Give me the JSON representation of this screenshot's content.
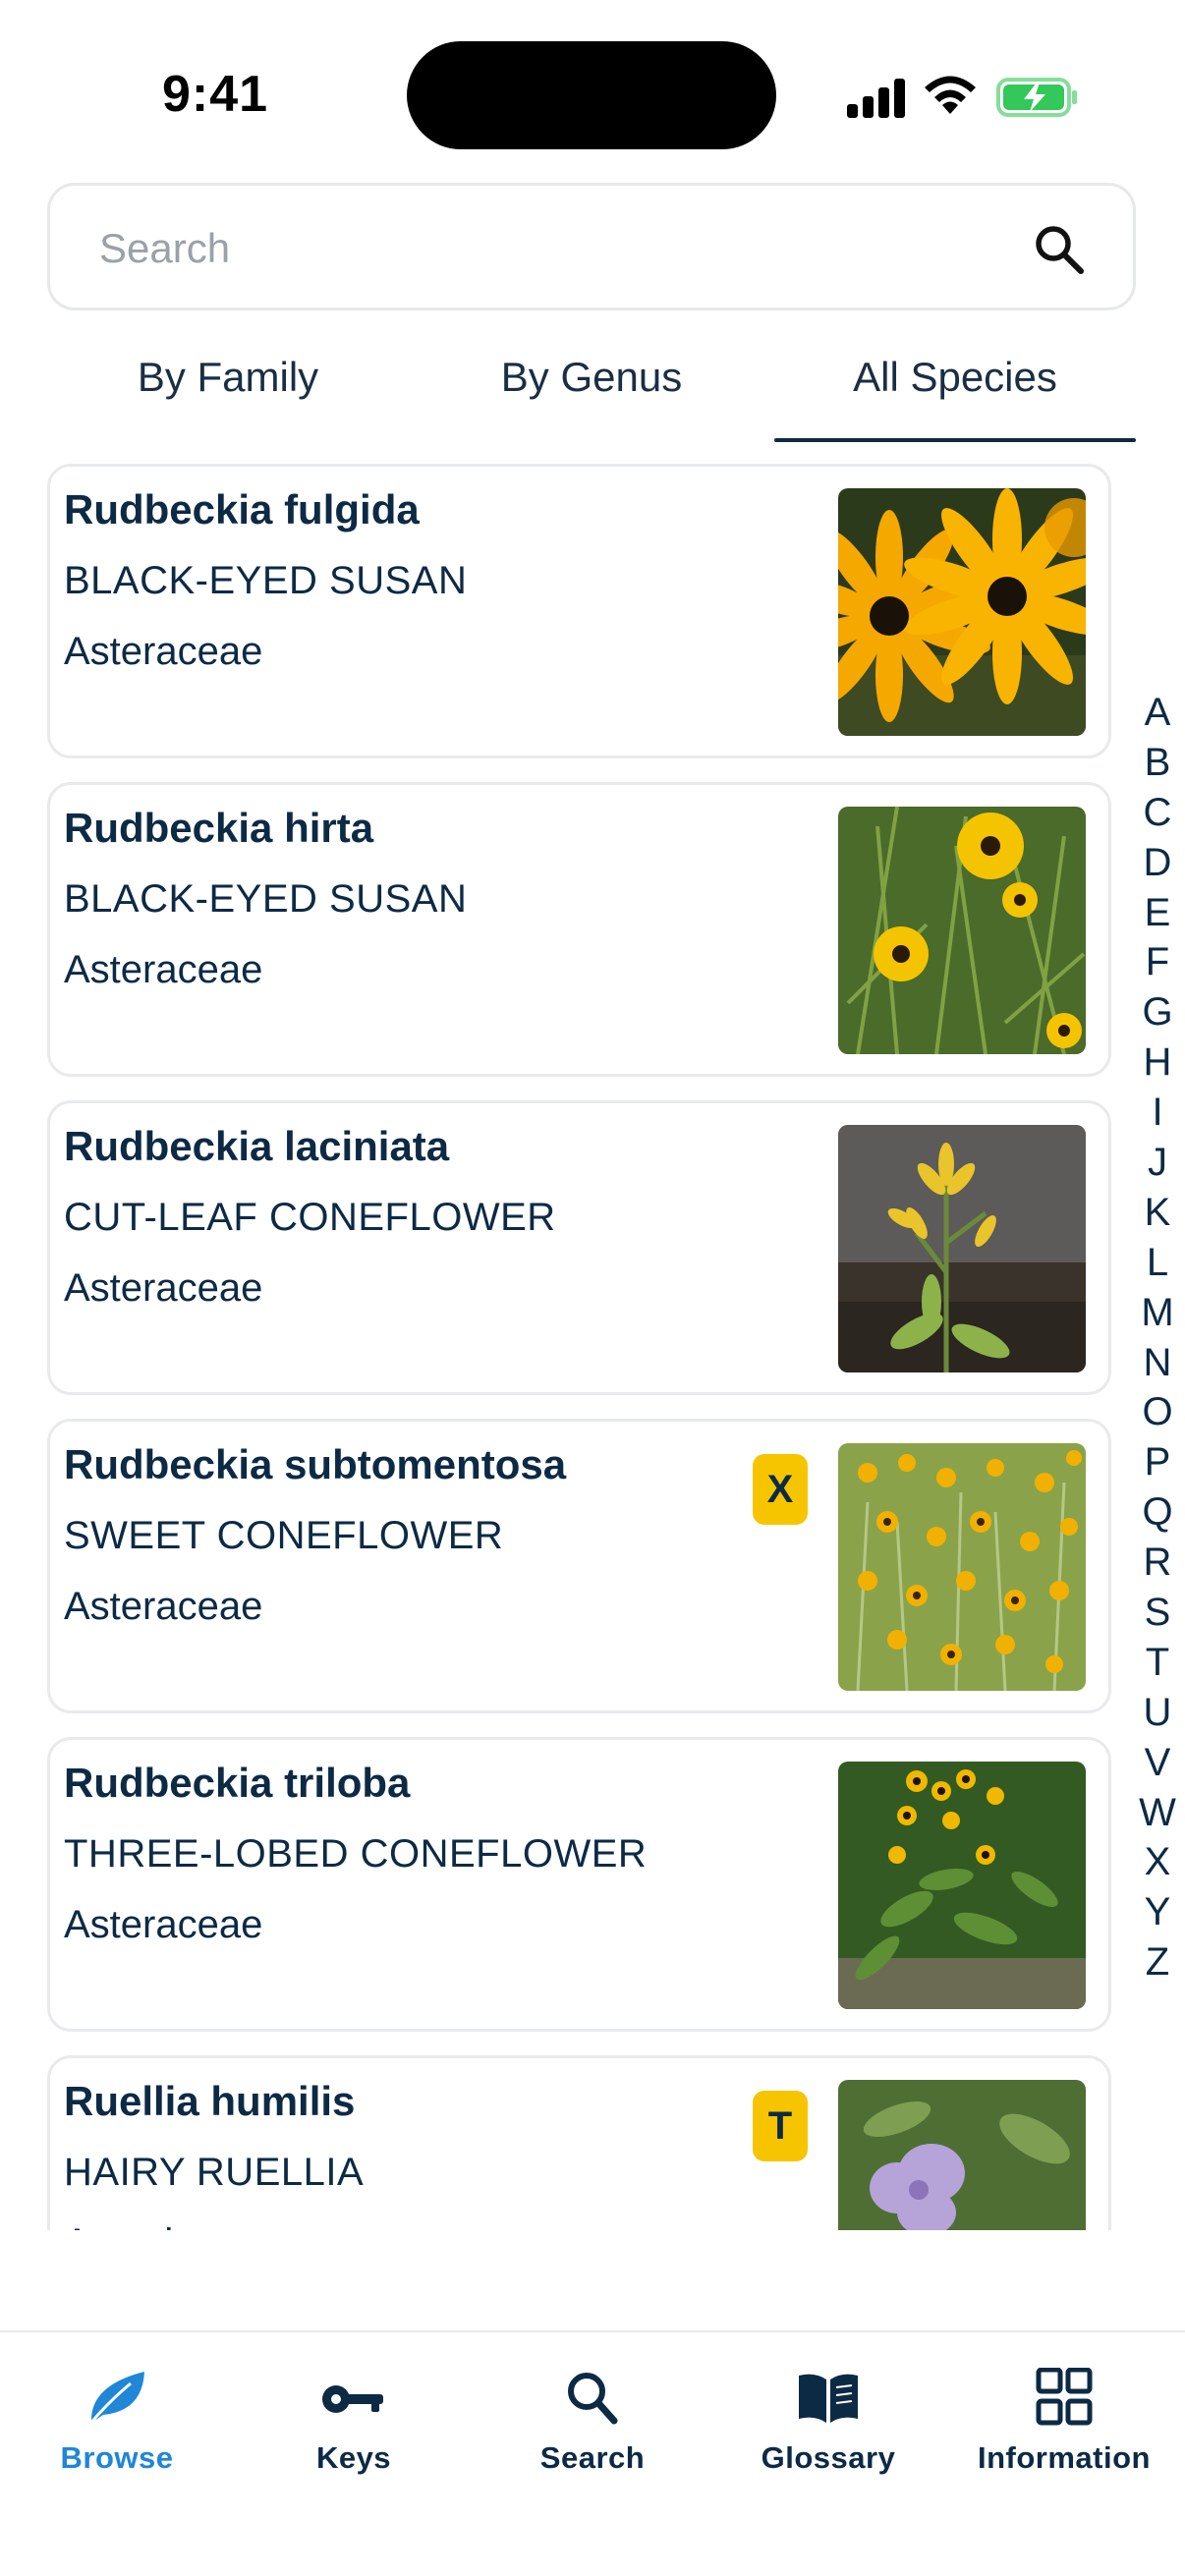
{
  "status_bar": {
    "time": "9:41"
  },
  "search": {
    "placeholder": "Search"
  },
  "tabs": [
    {
      "label": "By Family",
      "active": false
    },
    {
      "label": "By Genus",
      "active": false
    },
    {
      "label": "All Species",
      "active": true
    }
  ],
  "species": [
    {
      "scientific": "Rudbeckia fulgida",
      "common": "BLACK-EYED SUSAN",
      "family": "Asteraceae",
      "badge": ""
    },
    {
      "scientific": "Rudbeckia hirta",
      "common": "BLACK-EYED SUSAN",
      "family": "Asteraceae",
      "badge": ""
    },
    {
      "scientific": "Rudbeckia laciniata",
      "common": "CUT-LEAF CONEFLOWER",
      "family": "Asteraceae",
      "badge": ""
    },
    {
      "scientific": "Rudbeckia subtomentosa",
      "common": "SWEET CONEFLOWER",
      "family": "Asteraceae",
      "badge": "X"
    },
    {
      "scientific": "Rudbeckia triloba",
      "common": "THREE-LOBED CONEFLOWER",
      "family": "Asteraceae",
      "badge": ""
    },
    {
      "scientific": "Ruellia humilis",
      "common": "HAIRY RUELLIA",
      "family": "Acanthaceae",
      "badge": "T"
    }
  ],
  "alphabet": [
    "A",
    "B",
    "C",
    "D",
    "E",
    "F",
    "G",
    "H",
    "I",
    "J",
    "K",
    "L",
    "M",
    "N",
    "O",
    "P",
    "Q",
    "R",
    "S",
    "T",
    "U",
    "V",
    "W",
    "X",
    "Y",
    "Z"
  ],
  "tabbar": [
    {
      "label": "Browse",
      "icon": "leaf-icon",
      "active": true
    },
    {
      "label": "Keys",
      "icon": "key-icon",
      "active": false
    },
    {
      "label": "Search",
      "icon": "search-icon",
      "active": false
    },
    {
      "label": "Glossary",
      "icon": "book-icon",
      "active": false
    },
    {
      "label": "Information",
      "icon": "grid-icon",
      "active": false
    }
  ],
  "colors": {
    "accent": "#1f86d8",
    "text": "#0d2a45",
    "badge": "#f6c500"
  }
}
